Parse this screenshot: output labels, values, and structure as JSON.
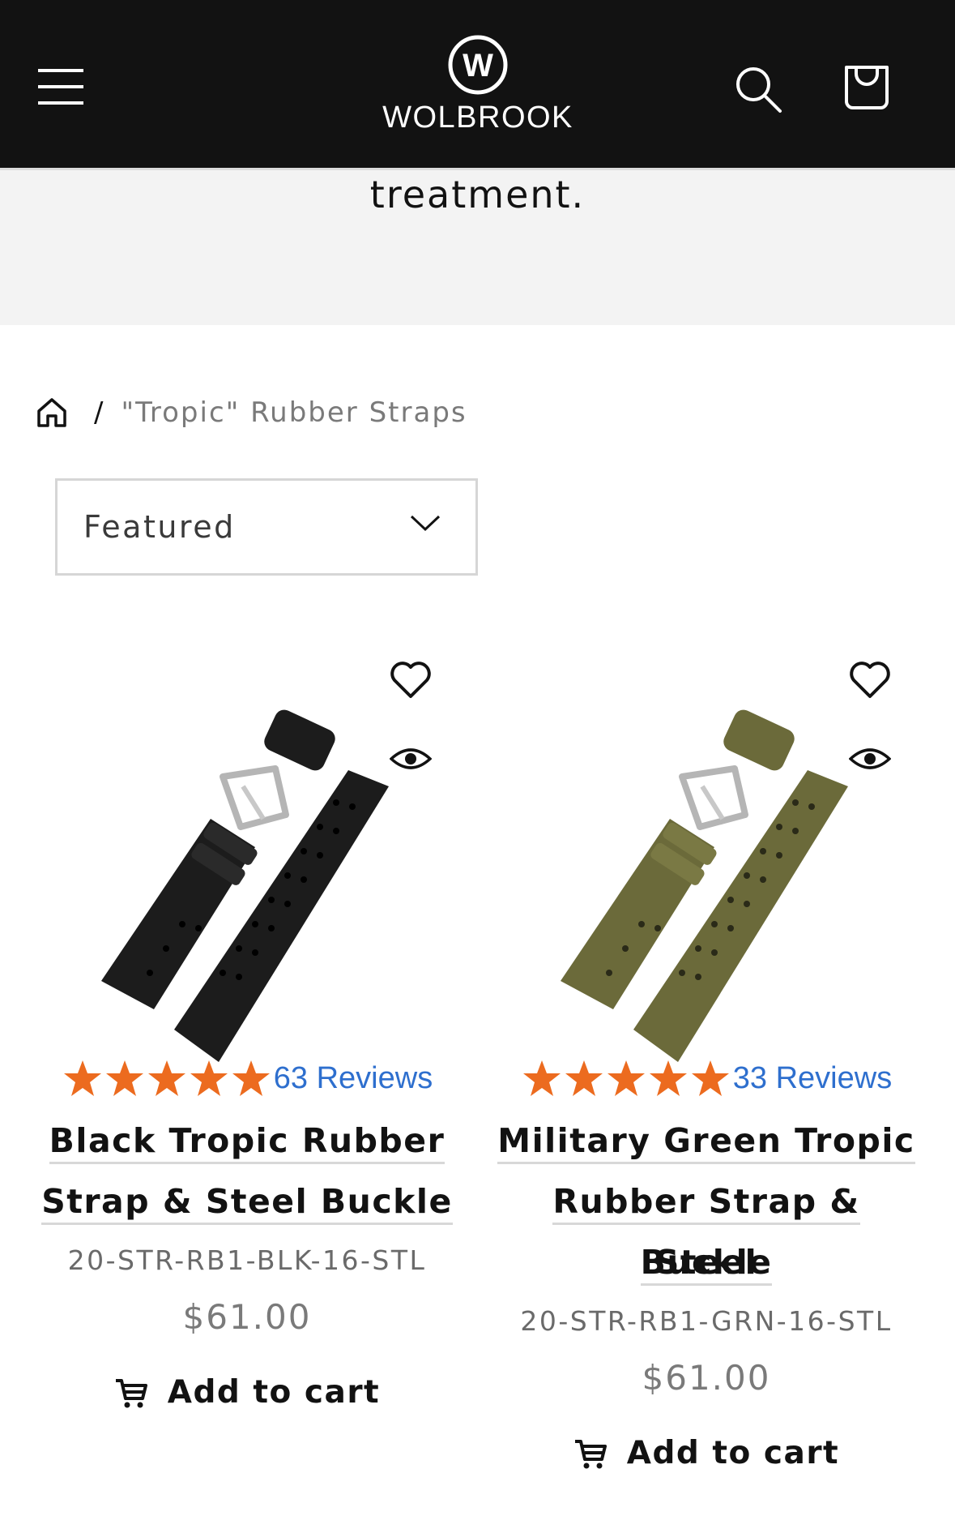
{
  "header": {
    "logo_text": "WOLBROOK",
    "logo_mark": "W",
    "menu_icon": "hamburger-menu-icon",
    "search_icon": "search-icon",
    "cart_icon": "cart-bag-icon",
    "background": "#121212"
  },
  "banner": {
    "text": "treatment."
  },
  "breadcrumb": {
    "home_icon": "home-icon",
    "separator": "/",
    "current": "\"Tropic\" Rubber Straps"
  },
  "sort": {
    "selected": "Featured"
  },
  "products": [
    {
      "reviews": "63 Reviews",
      "rating": 5,
      "title_line1": "Black Tropic Rubber",
      "title_line2": "Strap & Steel Buckle",
      "title_line3": "",
      "sku": "20-STR-RB1-BLK-16-STL",
      "price": "$61.00",
      "add_to_cart": "Add to cart",
      "strap_color": "#1c1c1c"
    },
    {
      "reviews": "33 Reviews",
      "rating": 5,
      "title_line1": "Military Green Tropic",
      "title_line2": "Rubber Strap & Steel",
      "title_line3": "Buckle",
      "sku": "20-STR-RB1-GRN-16-STL",
      "price": "$61.00",
      "add_to_cart": "Add to cart",
      "strap_color": "#6b6a3a"
    }
  ],
  "colors": {
    "star": "#ec6b1f",
    "reviews_link": "#2e6fce"
  }
}
